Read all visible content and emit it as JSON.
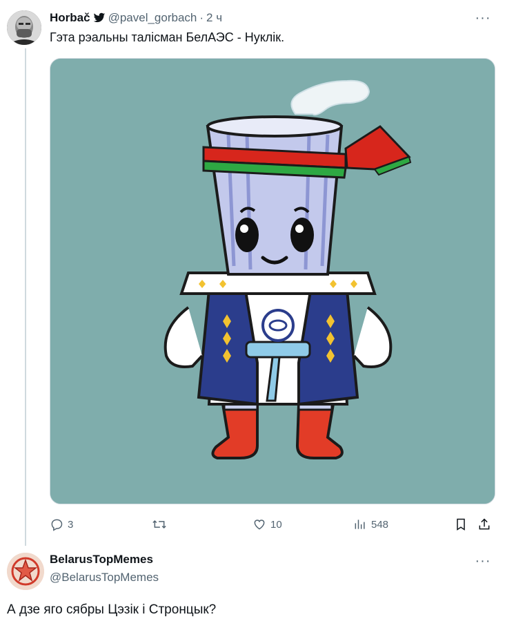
{
  "tweet1": {
    "name": "Horbač",
    "handle": "@pavel_gorbach",
    "dot": "·",
    "time": "2 ч",
    "text": "Гэта рэальны талісман БелАЭС - Нуклік.",
    "more": "···",
    "media_background": "#7fadac",
    "actions": {
      "replies": "3",
      "likes": "10",
      "views": "548"
    }
  },
  "tweet2": {
    "name": "BelarusTopMemes",
    "handle": "@BelarusTopMemes",
    "text": "А дзе яго сябры Цэзік і Стронцык?",
    "more": "···"
  },
  "icons": {
    "verified": "bird-icon",
    "reply": "reply-icon",
    "retweet": "retweet-icon",
    "like": "heart-icon",
    "views": "views-icon",
    "bookmark": "bookmark-icon",
    "share": "share-icon"
  }
}
